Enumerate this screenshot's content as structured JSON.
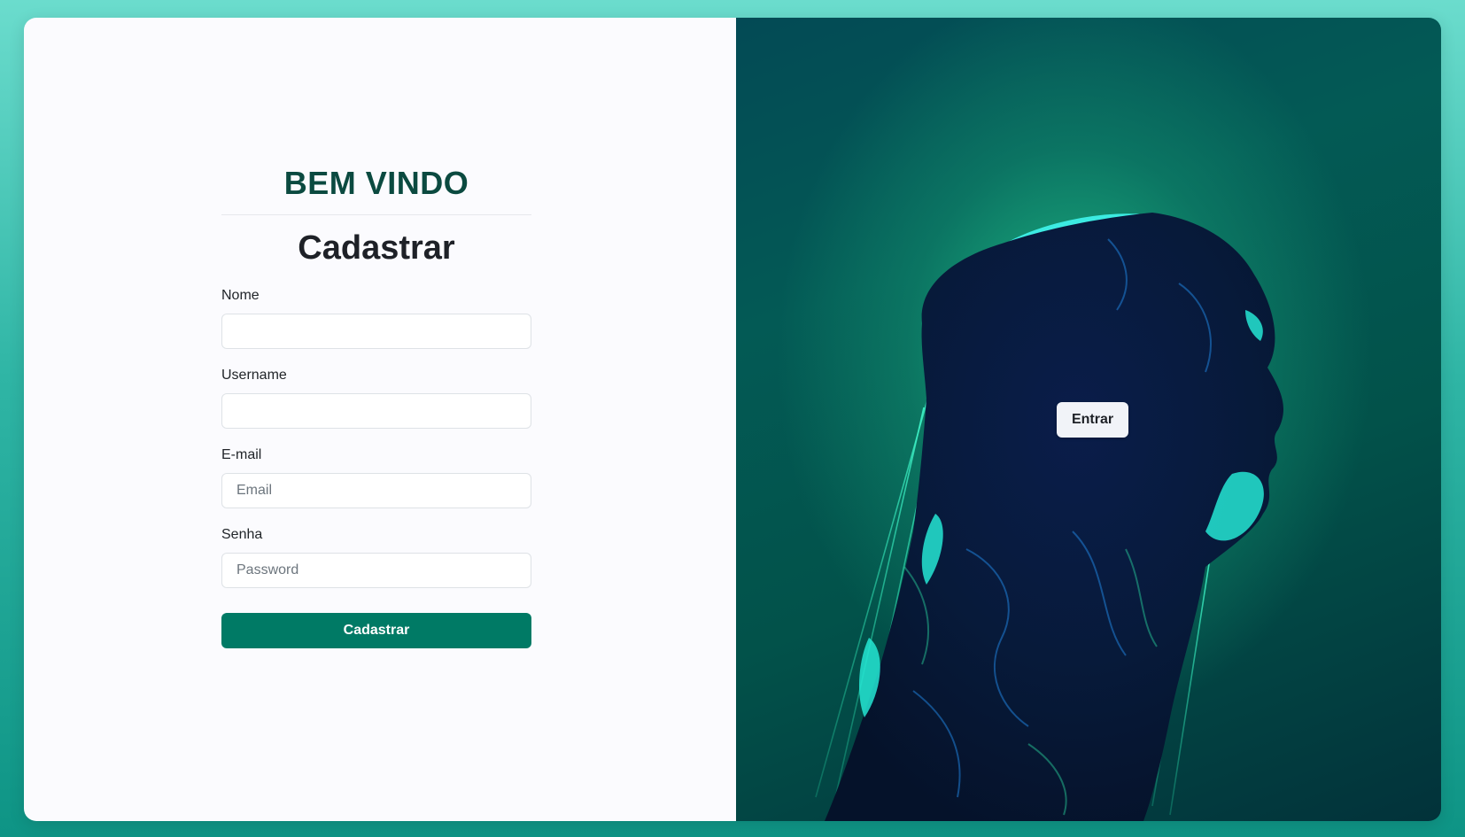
{
  "header": {
    "welcome": "BEM VINDO",
    "form_title": "Cadastrar"
  },
  "form": {
    "fields": [
      {
        "label": "Nome",
        "placeholder": "",
        "value": ""
      },
      {
        "label": "Username",
        "placeholder": "",
        "value": ""
      },
      {
        "label": "E-mail",
        "placeholder": "Email",
        "value": ""
      },
      {
        "label": "Senha",
        "placeholder": "Password",
        "value": ""
      }
    ],
    "submit_label": "Cadastrar"
  },
  "side": {
    "login_label": "Entrar"
  },
  "colors": {
    "accent": "#007a65",
    "welcome_text": "#0b4a40",
    "background_top": "#6bdccd",
    "background_bottom": "#0e9485"
  }
}
